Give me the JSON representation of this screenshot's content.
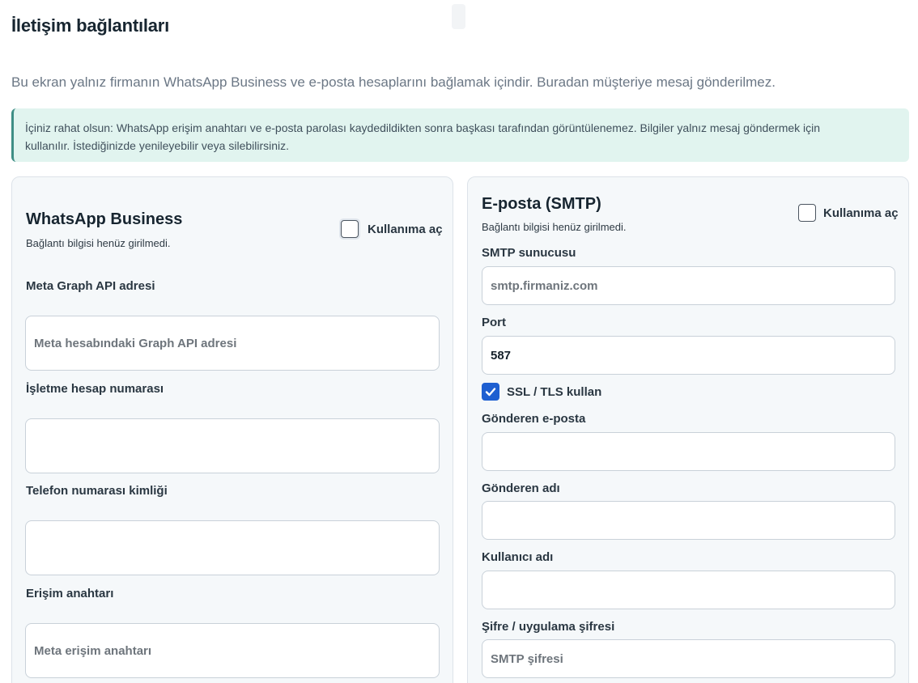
{
  "page": {
    "title": "İletişim bağlantıları",
    "intro": "Bu ekran yalnız firmanın WhatsApp Business ve e-posta hesaplarını bağlamak içindir. Buradan müşteriye mesaj gönderilmez.",
    "notice_line1": "İçiniz rahat olsun: WhatsApp erişim anahtarı ve e-posta parolası kaydedildikten sonra başkası tarafından görüntülenemez. Bilgiler yalnız mesaj göndermek için",
    "notice_line2": "kullanılır. İstediğinizde yenileyebilir veya silebilirsiniz."
  },
  "whatsapp": {
    "title": "WhatsApp Business",
    "status": "Bağlantı bilgisi henüz girilmedi.",
    "enable_label": "Kullanıma aç",
    "enabled": false,
    "fields": {
      "graph_api": {
        "label": "Meta Graph API adresi",
        "placeholder": "Meta hesabındaki Graph API adresi",
        "value": ""
      },
      "business_account": {
        "label": "İşletme hesap numarası",
        "placeholder": "",
        "value": ""
      },
      "phone_id": {
        "label": "Telefon numarası kimliği",
        "placeholder": "",
        "value": ""
      },
      "access_token": {
        "label": "Erişim anahtarı",
        "placeholder": "Meta erişim anahtarı",
        "value": ""
      }
    }
  },
  "email": {
    "title": "E-posta (SMTP)",
    "status": "Bağlantı bilgisi henüz girilmedi.",
    "enable_label": "Kullanıma aç",
    "enabled": false,
    "fields": {
      "smtp_host": {
        "label": "SMTP sunucusu",
        "placeholder": "smtp.firmaniz.com",
        "value": ""
      },
      "port": {
        "label": "Port",
        "placeholder": "",
        "value": "587"
      },
      "ssl": {
        "label": "SSL / TLS kullan",
        "checked": true
      },
      "sender_email": {
        "label": "Gönderen e-posta",
        "placeholder": "",
        "value": ""
      },
      "sender_name": {
        "label": "Gönderen adı",
        "placeholder": "",
        "value": ""
      },
      "username": {
        "label": "Kullanıcı adı",
        "placeholder": "",
        "value": ""
      },
      "password": {
        "label": "Şifre / uygulama şifresi",
        "placeholder": "SMTP şifresi",
        "value": ""
      }
    }
  },
  "colors": {
    "notice_bg": "#e1f4ef",
    "notice_border": "#3e8e85",
    "checkbox_checked": "#1e5fd1",
    "panel_bg": "#f5f8fa"
  },
  "icons": {
    "checkmark": "check-icon"
  }
}
